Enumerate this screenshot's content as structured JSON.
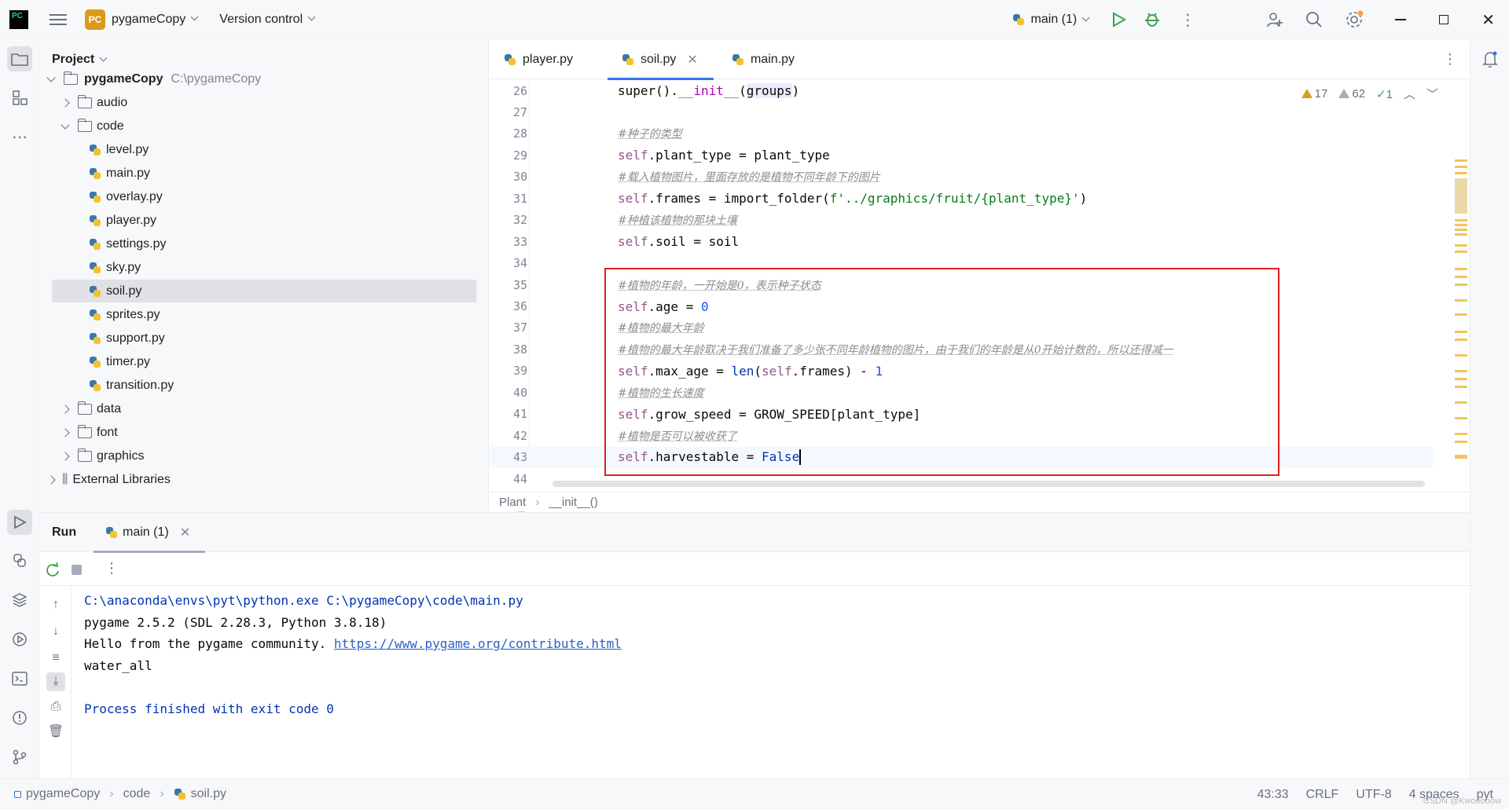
{
  "titlebar": {
    "logo": "PyCharm",
    "project_badge": "PC",
    "project_name": "pygameCopy",
    "vcs": "Version control",
    "run_config": "main (1)"
  },
  "project_panel": {
    "title": "Project",
    "root": {
      "name": "pygameCopy",
      "path": "C:\\pygameCopy"
    },
    "tree": [
      {
        "label": "audio",
        "type": "folder",
        "depth": 1,
        "expanded": false
      },
      {
        "label": "code",
        "type": "folder",
        "depth": 1,
        "expanded": true
      },
      {
        "label": "level.py",
        "type": "py",
        "depth": 2
      },
      {
        "label": "main.py",
        "type": "py",
        "depth": 2
      },
      {
        "label": "overlay.py",
        "type": "py",
        "depth": 2
      },
      {
        "label": "player.py",
        "type": "py",
        "depth": 2
      },
      {
        "label": "settings.py",
        "type": "py",
        "depth": 2
      },
      {
        "label": "sky.py",
        "type": "py",
        "depth": 2
      },
      {
        "label": "soil.py",
        "type": "py",
        "depth": 2,
        "selected": true
      },
      {
        "label": "sprites.py",
        "type": "py",
        "depth": 2
      },
      {
        "label": "support.py",
        "type": "py",
        "depth": 2
      },
      {
        "label": "timer.py",
        "type": "py",
        "depth": 2
      },
      {
        "label": "transition.py",
        "type": "py",
        "depth": 2
      },
      {
        "label": "data",
        "type": "folder",
        "depth": 1,
        "expanded": false
      },
      {
        "label": "font",
        "type": "folder",
        "depth": 1,
        "expanded": false
      },
      {
        "label": "graphics",
        "type": "folder",
        "depth": 1,
        "expanded": false
      },
      {
        "label": "External Libraries",
        "type": "lib",
        "depth": 0,
        "expanded": false
      }
    ]
  },
  "editor": {
    "tabs": [
      {
        "label": "player.py",
        "active": false
      },
      {
        "label": "soil.py",
        "active": true
      },
      {
        "label": "main.py",
        "active": false
      }
    ],
    "inspections": {
      "warnings": "17",
      "weak_warnings": "62",
      "typos": "1"
    },
    "lines": [
      {
        "n": "26",
        "code": "super().__init__(groups)"
      },
      {
        "n": "27",
        "code": ""
      },
      {
        "n": "28",
        "code": "#种子的类型"
      },
      {
        "n": "29",
        "code": "self.plant_type = plant_type"
      },
      {
        "n": "30",
        "code": "#载入植物图片，里面存放的是植物不同年龄下的图片"
      },
      {
        "n": "31",
        "code": "self.frames = import_folder(f'../graphics/fruit/{plant_type}')"
      },
      {
        "n": "32",
        "code": "#种植该植物的那块土壤"
      },
      {
        "n": "33",
        "code": "self.soil = soil"
      },
      {
        "n": "34",
        "code": ""
      },
      {
        "n": "35",
        "code": "#植物的年龄，一开始是0，表示种子状态"
      },
      {
        "n": "36",
        "code": "self.age = 0"
      },
      {
        "n": "37",
        "code": "#植物的最大年龄"
      },
      {
        "n": "38",
        "code": "#植物的最大年龄取决于我们准备了多少张不同年龄植物的图片，由于我们的年龄是从0开始计数的，所以还得减一"
      },
      {
        "n": "39",
        "code": "self.max_age = len(self.frames) - 1"
      },
      {
        "n": "40",
        "code": "#植物的生长速度"
      },
      {
        "n": "41",
        "code": "self.grow_speed = GROW_SPEED[plant_type]"
      },
      {
        "n": "42",
        "code": "#植物是否可以被收获了"
      },
      {
        "n": "43",
        "code": "self.harvestable = False"
      },
      {
        "n": "44",
        "code": ""
      }
    ],
    "breadcrumb": [
      "Plant",
      "__init__()"
    ]
  },
  "run_panel": {
    "title": "Run",
    "tab": "main (1)",
    "output": [
      {
        "text": "C:\\anaconda\\envs\\pyt\\python.exe C:\\pygameCopy\\code\\main.py",
        "kind": "cmd"
      },
      {
        "text": "pygame 2.5.2 (SDL 2.28.3, Python 3.8.18)",
        "kind": "out"
      },
      {
        "text": "Hello from the pygame community. ",
        "link": "https://www.pygame.org/contribute.html",
        "kind": "out"
      },
      {
        "text": "water_all",
        "kind": "out"
      },
      {
        "text": "",
        "kind": "out"
      },
      {
        "text": "Process finished with exit code 0",
        "kind": "cmd"
      }
    ]
  },
  "statusbar": {
    "path": [
      "pygameCopy",
      "code",
      "soil.py"
    ],
    "position": "43:33",
    "line_sep": "CRLF",
    "encoding": "UTF-8",
    "indent": "4 spaces",
    "interpreter": "pyt",
    "watermark": "CSDN @Kwooooow"
  },
  "colors": {
    "accent": "#3574f0",
    "highlight_box": "#e02020",
    "run_green": "#3fa34d",
    "warning": "#d99b1c"
  }
}
